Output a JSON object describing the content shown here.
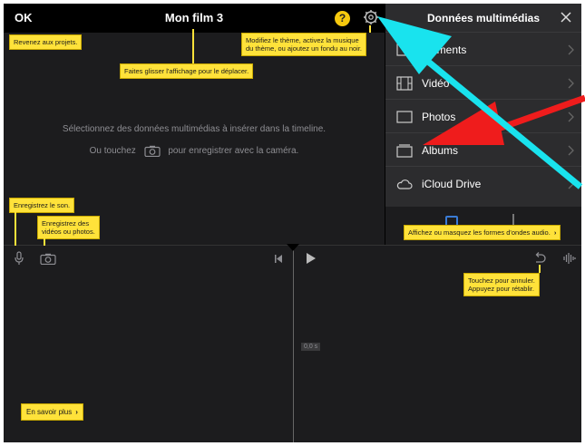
{
  "header": {
    "ok_label": "OK",
    "title": "Mon film 3",
    "help_label": "?"
  },
  "viewer": {
    "empty_line1": "Sélectionnez des données multimédias à insérer dans la timeline.",
    "empty_line2_before": "Ou touchez",
    "empty_line2_after": "pour enregistrer avec la caméra."
  },
  "media": {
    "title": "Données multimédias",
    "items": [
      {
        "label": "Moments",
        "icon": "moments-icon"
      },
      {
        "label": "Vidéo",
        "icon": "film-icon"
      },
      {
        "label": "Photos",
        "icon": "photo-icon"
      },
      {
        "label": "Albums",
        "icon": "album-icon"
      },
      {
        "label": "iCloud Drive",
        "icon": "cloud-icon"
      }
    ]
  },
  "timeline": {
    "timecode": "0,0 s"
  },
  "tooltips": {
    "projects": "Revenez aux projets.",
    "drag": "Faites glisser l'affichage pour le déplacer.",
    "theme_line1": "Modifiez le thème, activez la musique",
    "theme_line2": "du thème, ou ajoutez un fondu au noir.",
    "sound": "Enregistrez le son.",
    "video_line1": "Enregistrez des",
    "video_line2": "vidéos ou photos.",
    "waveform": "Affichez ou masquez les formes d'ondes audio.",
    "undo_line1": "Touchez pour annuler.",
    "undo_line2": "Appuyez pour rétablir.",
    "learn_more": "En savoir plus"
  },
  "colors": {
    "tooltip": "#ffe23a",
    "cyan_arrow": "#19e3ee",
    "red_arrow": "#ef1c1c",
    "help_badge": "#f6c90e"
  }
}
